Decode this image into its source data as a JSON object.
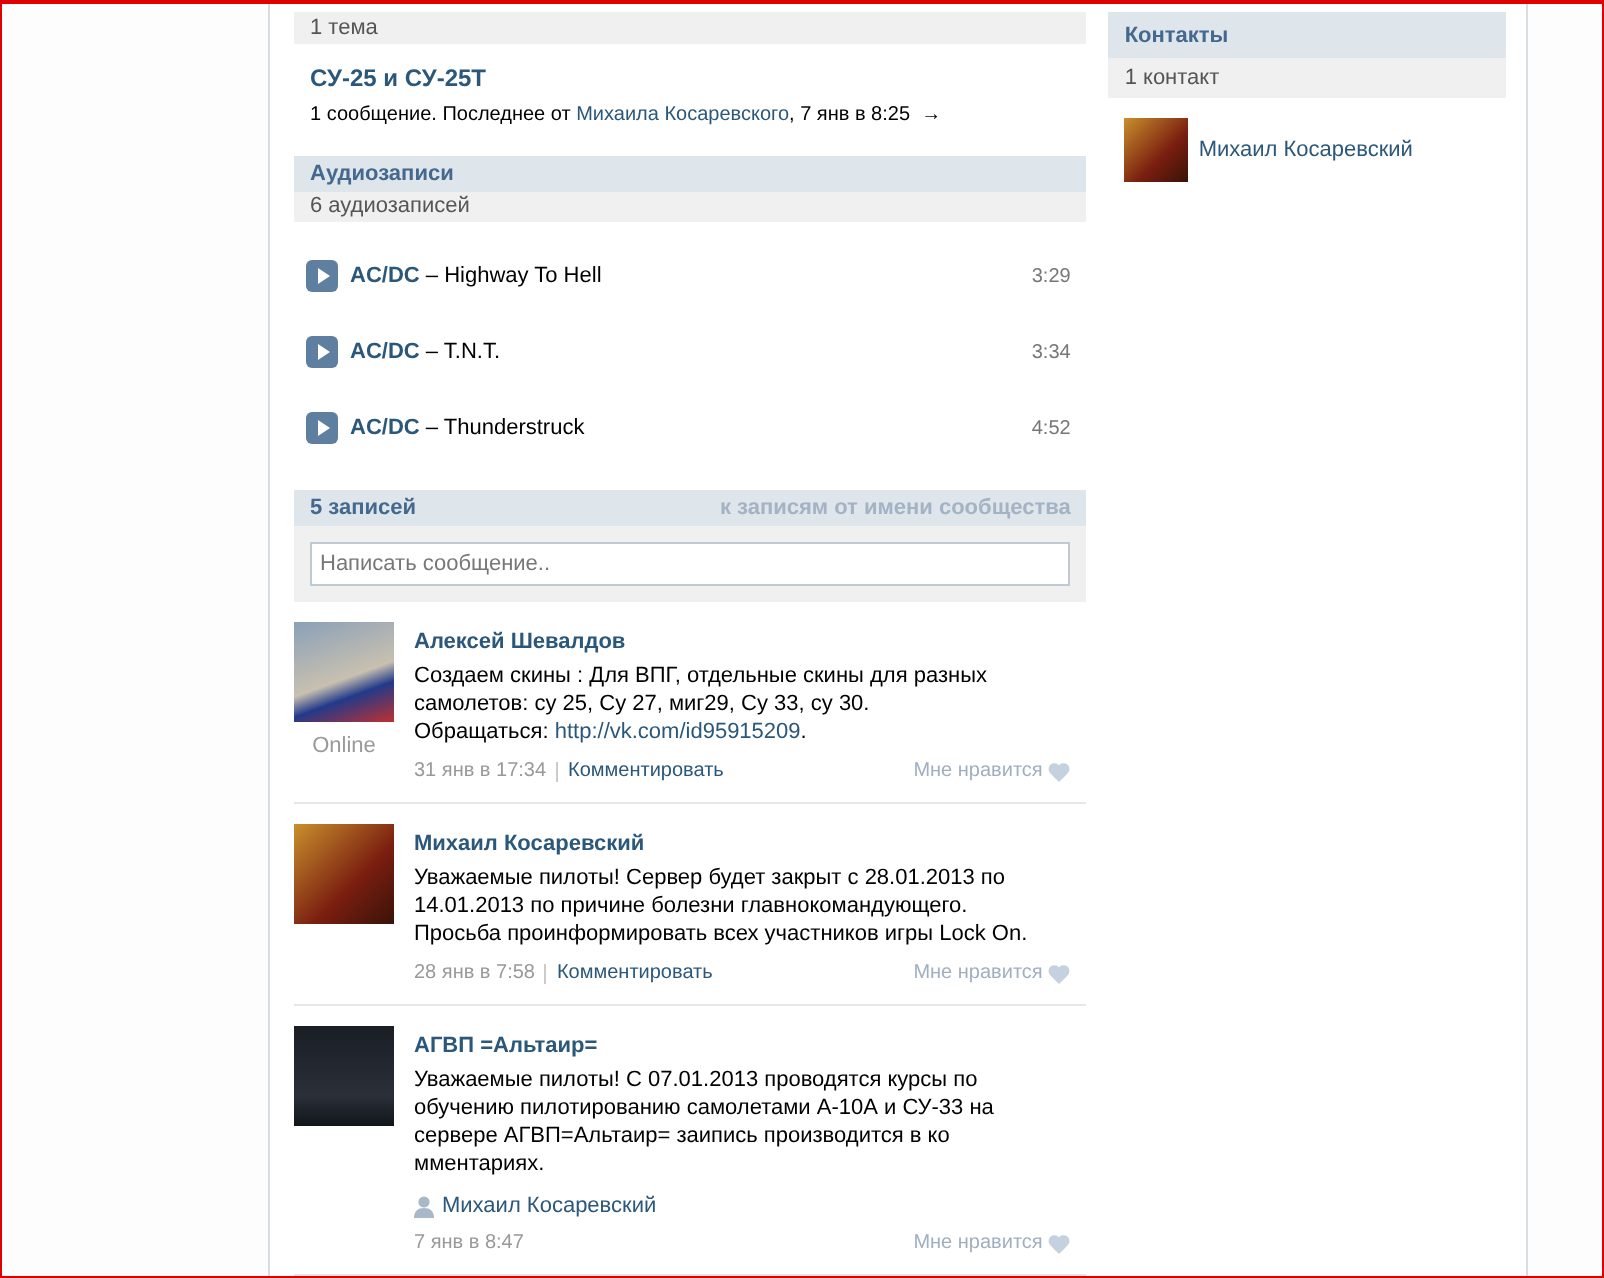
{
  "topics": {
    "count": "1 тема",
    "items": [
      {
        "title": "СУ-25 и СУ-25Т",
        "summary": "1 сообщение. Последнее от",
        "author": "Михаила Косаревского",
        "date": ", 7 янв в 8:25",
        "arrow": "→"
      }
    ]
  },
  "audio": {
    "title": "Аудиозаписи",
    "count": "6 аудиозаписей",
    "tracks": [
      {
        "artist": "AC/DC",
        "separator": "–",
        "title": "Highway To Hell",
        "duration": "3:29"
      },
      {
        "artist": "AC/DC",
        "separator": "–",
        "title": "T.N.T.",
        "duration": "3:34"
      },
      {
        "artist": "AC/DC",
        "separator": "–",
        "title": "Thunderstruck",
        "duration": "4:52"
      }
    ]
  },
  "wall": {
    "title": "5 записей",
    "link": "к записям от имени сообщества",
    "input": {
      "placeholder": "Написать сообщение.."
    },
    "posts": [
      {
        "author": "Алексей Шевалдов",
        "text": "Создаем скины : Для ВПГ, отдельные скины для разных\nсамолетов: су 25, Су 27, миг29, Су 33, су 30.\nОбращаться: ",
        "link": "http://vk.com/id95915209",
        "text_end": ".",
        "status": "Online",
        "date": "31 янв в 17:34",
        "comment": "Комментировать",
        "like": "Мне нравится"
      },
      {
        "author": "Михаил Косаревский",
        "text": "Уважаемые пилоты! Сервер будет закрыт с 28.01.2013 по\n14.01.2013 по причине болезни главнокомандующего.\nПросьба проинформировать всех участников игры Lock On.",
        "date": "28 янв в 7:58",
        "comment": "Комментировать",
        "like": "Мне нравится"
      },
      {
        "author": "АГВП =Альтаир=",
        "text": "Уважаемые пилоты! С 07.01.2013 проводятся курсы по\nобучению пилотированию самолетами А-10А и СУ-33 на\nсервере АГВП=Альтаир= заипись производится в ко\nмментариях.",
        "signer": "Михаил Косаревский",
        "date": "7 янв в 8:47",
        "like": "Мне нравится"
      }
    ]
  },
  "contacts": {
    "title": "Контакты",
    "count": "1 контакт",
    "items": [
      {
        "name": "Михаил Косаревский"
      }
    ]
  }
}
